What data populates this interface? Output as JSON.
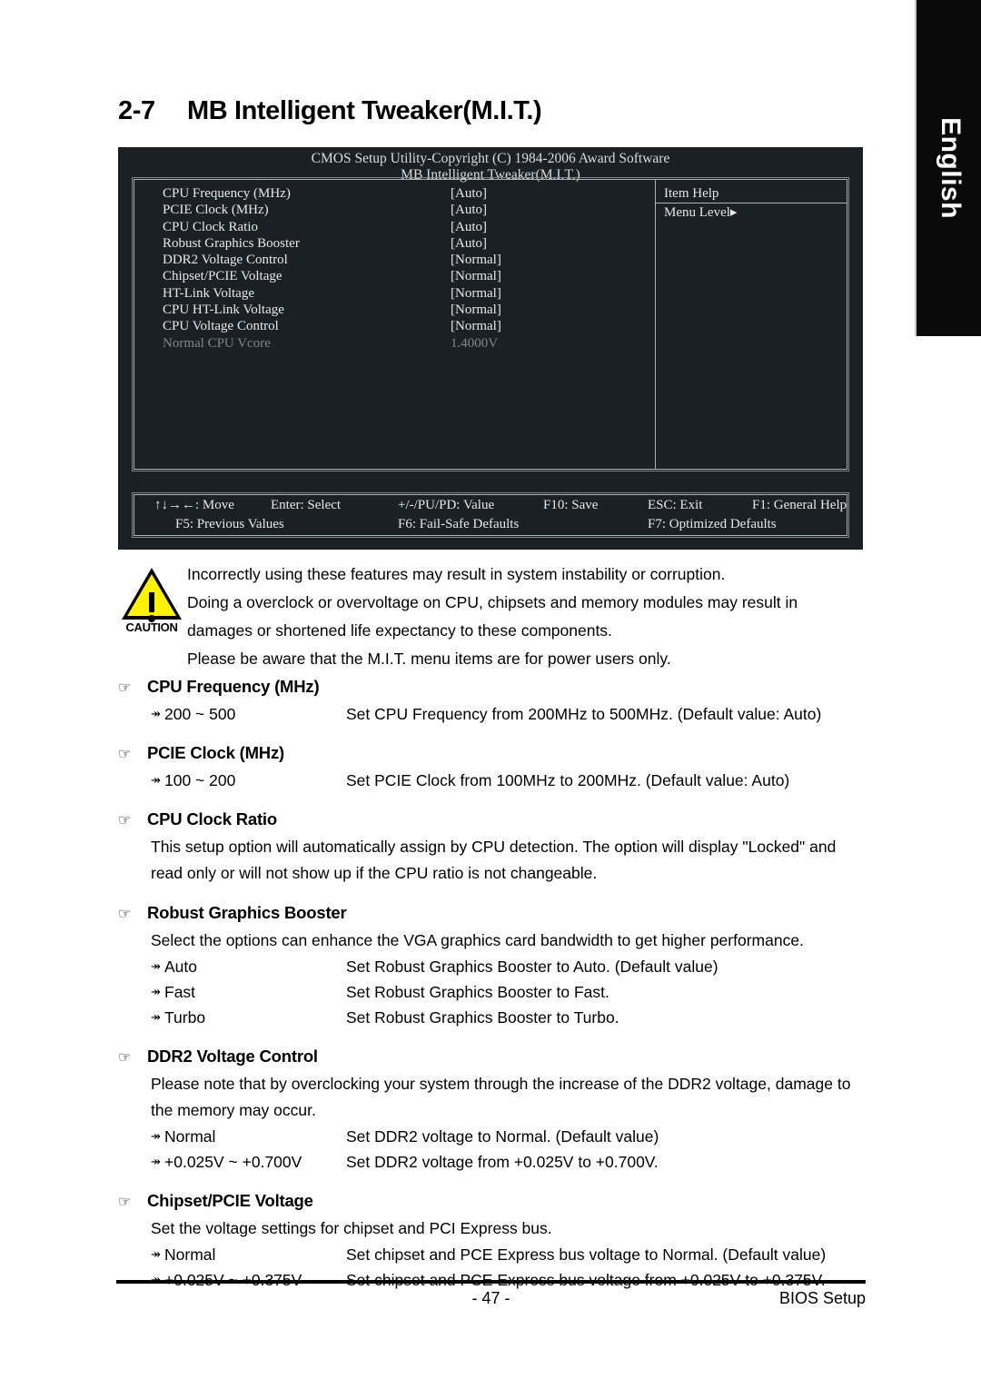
{
  "language_tab": {
    "label": "English"
  },
  "title": {
    "number": "2-7",
    "text": "MB Intelligent Tweaker(M.I.T.)"
  },
  "bios": {
    "header_line1": "CMOS Setup Utility-Copyright (C) 1984-2006 Award Software",
    "header_line2": "MB Intelligent Tweaker(M.I.T.)",
    "items": [
      {
        "label": "CPU Frequency (MHz)",
        "value": "[Auto]",
        "dim": false
      },
      {
        "label": "PCIE Clock (MHz)",
        "value": "[Auto]",
        "dim": false
      },
      {
        "label": "CPU Clock Ratio",
        "value": "[Auto]",
        "dim": false
      },
      {
        "label": "Robust Graphics Booster",
        "value": "[Auto]",
        "dim": false
      },
      {
        "label": "DDR2 Voltage Control",
        "value": "[Normal]",
        "dim": false
      },
      {
        "label": "Chipset/PCIE Voltage",
        "value": "[Normal]",
        "dim": false
      },
      {
        "label": "HT-Link Voltage",
        "value": "[Normal]",
        "dim": false
      },
      {
        "label": "CPU HT-Link Voltage",
        "value": "[Normal]",
        "dim": false
      },
      {
        "label": "CPU Voltage Control",
        "value": "[Normal]",
        "dim": false
      },
      {
        "label": "Normal CPU Vcore",
        "value": "1.4000V",
        "dim": true
      }
    ],
    "item_help": {
      "title": "Item Help",
      "menu_level": "Menu Level▸"
    },
    "keys_row1": [
      "↑↓→←: Move",
      "Enter: Select",
      "+/-/PU/PD: Value",
      "F10: Save",
      "ESC: Exit",
      "F1: General Help"
    ],
    "keys_row2": [
      "F5: Previous Values",
      "F6: Fail-Safe Defaults",
      "F7: Optimized Defaults"
    ]
  },
  "caution": {
    "word": "CAUTION",
    "lines": [
      "Incorrectly using these features may result in system instability or corruption.",
      "Doing a overclock or overvoltage on CPU, chipsets and memory modules may result in",
      "damages or shortened life expectancy to these components.",
      "Please be aware that the M.I.T. menu items are for power users only."
    ]
  },
  "sections": [
    {
      "heading": "CPU Frequency (MHz)",
      "paragraphs": [],
      "options": [
        {
          "name": "200 ~ 500",
          "desc": "Set CPU Frequency from 200MHz to 500MHz. (Default value: Auto)"
        }
      ]
    },
    {
      "heading": "PCIE Clock (MHz)",
      "paragraphs": [],
      "options": [
        {
          "name": "100 ~ 200",
          "desc": "Set PCIE Clock from 100MHz to 200MHz. (Default value: Auto)"
        }
      ]
    },
    {
      "heading": "CPU Clock Ratio",
      "paragraphs": [
        "This setup option will automatically assign by CPU detection. The option will display \"Locked\" and read only or will not show up if the CPU ratio is not changeable."
      ],
      "options": []
    },
    {
      "heading": "Robust Graphics Booster",
      "paragraphs": [
        "Select the options can enhance the VGA graphics card bandwidth to get higher performance."
      ],
      "options": [
        {
          "name": "Auto",
          "desc": "Set Robust Graphics Booster to Auto. (Default value)"
        },
        {
          "name": "Fast",
          "desc": "Set Robust Graphics Booster to Fast."
        },
        {
          "name": "Turbo",
          "desc": "Set Robust Graphics Booster to Turbo."
        }
      ]
    },
    {
      "heading": "DDR2 Voltage Control",
      "paragraphs": [
        "Please note that by overclocking your system through the increase of the DDR2 voltage, damage to the memory may occur."
      ],
      "options": [
        {
          "name": "Normal",
          "desc": "Set DDR2 voltage to Normal. (Default value)"
        },
        {
          "name": "+0.025V ~ +0.700V",
          "desc": "Set DDR2 voltage from +0.025V to +0.700V."
        }
      ]
    },
    {
      "heading": "Chipset/PCIE Voltage",
      "paragraphs": [
        "Set the voltage settings for chipset and PCI Express bus."
      ],
      "options": [
        {
          "name": "Normal",
          "desc": "Set chipset and PCE Express bus voltage to Normal. (Default value)"
        },
        {
          "name": "+0.025V ~ +0.375V",
          "desc": "Set chipset and PCE Express bus voltage from +0.025V to +0.375V."
        }
      ]
    }
  ],
  "footer": {
    "page_number": "- 47 -",
    "section_label": "BIOS Setup"
  },
  "icons": {
    "hand_bullet": "☞",
    "option_arrow": "↠"
  }
}
